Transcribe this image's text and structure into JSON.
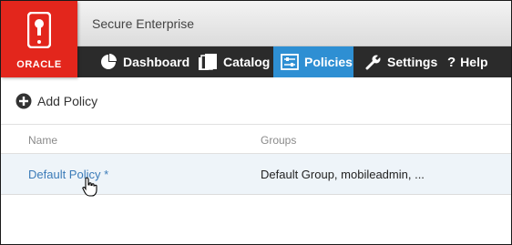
{
  "app": {
    "title": "Secure Enterprise",
    "logo_text": "ORACLE",
    "brand_color": "#e3261c",
    "accent_color": "#2e8fd3"
  },
  "nav": {
    "items": [
      {
        "label": "Dashboard",
        "icon": "pie-chart-icon"
      },
      {
        "label": "Catalog",
        "icon": "catalog-icon"
      },
      {
        "label": "Policies",
        "icon": "policies-icon",
        "active": true
      },
      {
        "label": "Settings",
        "icon": "wrench-icon"
      },
      {
        "label": "Help",
        "icon": "question-icon"
      }
    ]
  },
  "toolbar": {
    "add_label": "Add Policy"
  },
  "table": {
    "columns": [
      "Name",
      "Groups"
    ],
    "rows": [
      {
        "name": "Default Policy *",
        "groups": "Default Group, mobileadmin, ..."
      }
    ]
  }
}
